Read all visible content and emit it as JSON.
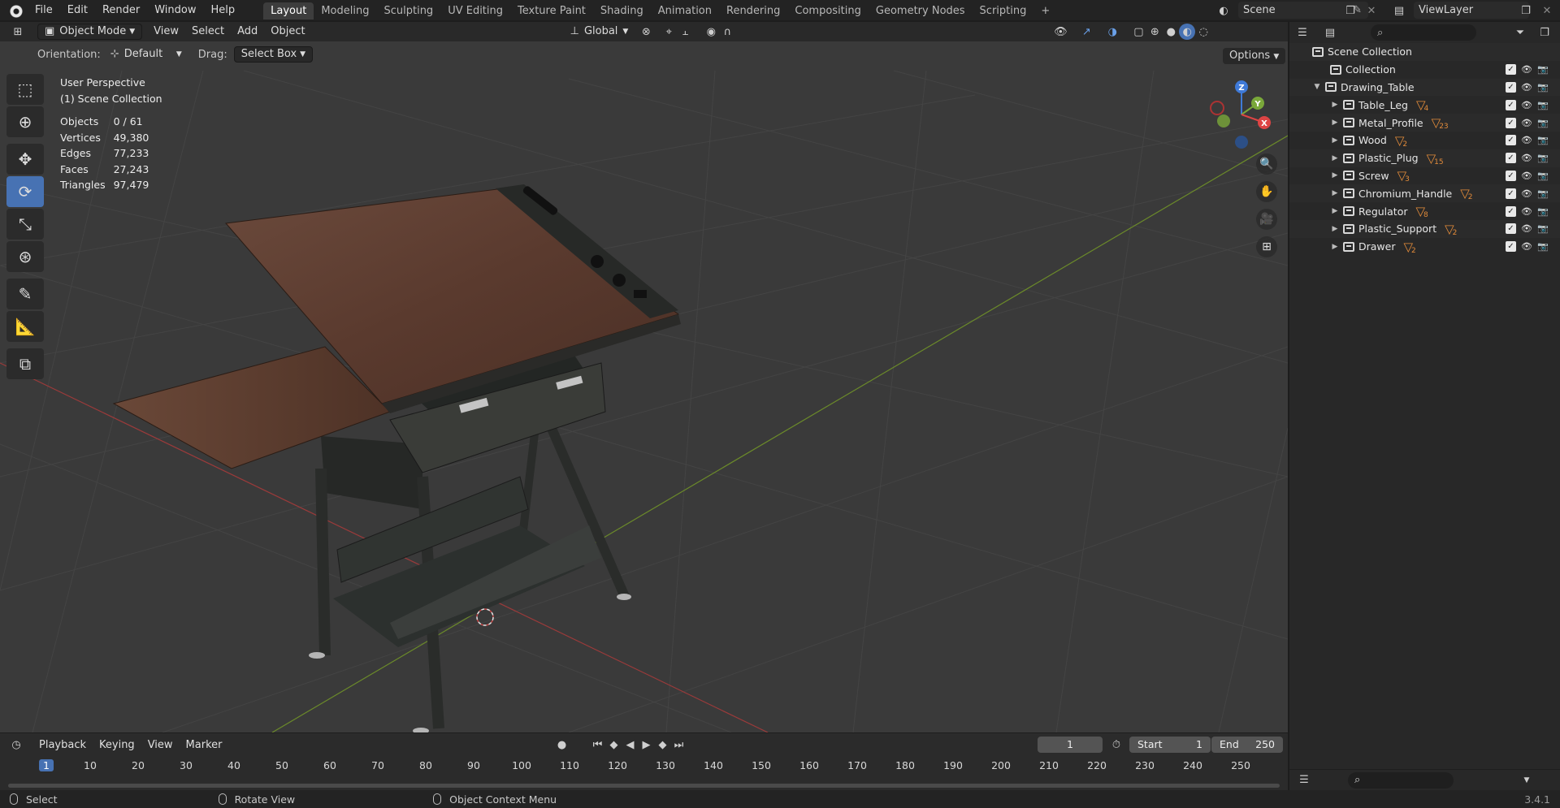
{
  "topbar": {
    "menus": [
      "File",
      "Edit",
      "Render",
      "Window",
      "Help"
    ],
    "workspaces": [
      "Layout",
      "Modeling",
      "Sculpting",
      "UV Editing",
      "Texture Paint",
      "Shading",
      "Animation",
      "Rendering",
      "Compositing",
      "Geometry Nodes",
      "Scripting"
    ],
    "active_workspace": "Layout",
    "add_workspace": "+",
    "scene_name": "Scene",
    "view_layer": "ViewLayer"
  },
  "viewport_header": {
    "mode": "Object Mode",
    "menus": [
      "View",
      "Select",
      "Add",
      "Object"
    ],
    "transform_orientation": "Global",
    "orientation_label": "Orientation:",
    "orientation_value": "Default",
    "drag_label": "Drag:",
    "drag_value": "Select Box",
    "options": "Options"
  },
  "overlay": {
    "perspective": "User Perspective",
    "collection": "(1) Scene Collection",
    "stats": [
      {
        "label": "Objects",
        "value": "0 / 61"
      },
      {
        "label": "Vertices",
        "value": "49,380"
      },
      {
        "label": "Edges",
        "value": "77,233"
      },
      {
        "label": "Faces",
        "value": "27,243"
      },
      {
        "label": "Triangles",
        "value": "97,479"
      }
    ]
  },
  "gizmo": {
    "x": "X",
    "y": "Y",
    "z": "Z"
  },
  "tools": [
    "select-box-icon",
    "cursor-icon",
    "move-icon",
    "rotate-icon",
    "scale-icon",
    "transform-icon",
    "annotate-icon",
    "measure-icon",
    "add-cube-icon"
  ],
  "outliner": {
    "root": "Scene Collection",
    "items": [
      {
        "name": "Collection",
        "level": 1,
        "arrow": "",
        "count": ""
      },
      {
        "name": "Drawing_Table",
        "level": 1,
        "arrow": "▼",
        "count": ""
      },
      {
        "name": "Table_Leg",
        "level": 2,
        "arrow": "▶",
        "count": "4"
      },
      {
        "name": "Metal_Profile",
        "level": 2,
        "arrow": "▶",
        "count": "23"
      },
      {
        "name": "Wood",
        "level": 2,
        "arrow": "▶",
        "count": "2"
      },
      {
        "name": "Plastic_Plug",
        "level": 2,
        "arrow": "▶",
        "count": "15"
      },
      {
        "name": "Screw",
        "level": 2,
        "arrow": "▶",
        "count": "3"
      },
      {
        "name": "Chromium_Handle",
        "level": 2,
        "arrow": "▶",
        "count": "2"
      },
      {
        "name": "Regulator",
        "level": 2,
        "arrow": "▶",
        "count": "8"
      },
      {
        "name": "Plastic_Support",
        "level": 2,
        "arrow": "▶",
        "count": "2"
      },
      {
        "name": "Drawer",
        "level": 2,
        "arrow": "▶",
        "count": "2"
      }
    ]
  },
  "timeline": {
    "menus": [
      "Playback",
      "Keying",
      "View",
      "Marker"
    ],
    "current_frame": "1",
    "start_label": "Start",
    "start": "1",
    "end_label": "End",
    "end": "250",
    "ruler": [
      "1",
      "10",
      "20",
      "30",
      "40",
      "50",
      "60",
      "70",
      "80",
      "90",
      "100",
      "110",
      "120",
      "130",
      "140",
      "150",
      "160",
      "170",
      "180",
      "190",
      "200",
      "210",
      "220",
      "230",
      "240",
      "250"
    ]
  },
  "statusbar": {
    "select": "Select",
    "rotate": "Rotate View",
    "context": "Object Context Menu",
    "version": "3.4.1"
  }
}
